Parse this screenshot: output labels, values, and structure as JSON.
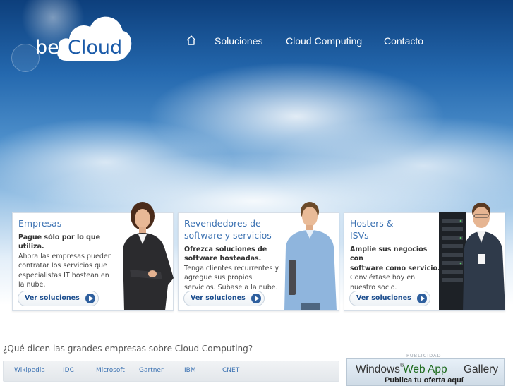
{
  "header": {
    "logo": {
      "part1": "be",
      "part2": "Cloud"
    },
    "nav": [
      {
        "label": "Soluciones"
      },
      {
        "label": "Cloud Computing"
      },
      {
        "label": "Contacto"
      }
    ],
    "home_icon": "home-icon"
  },
  "cards": [
    {
      "title_line1": "Empresas",
      "title_line2": "",
      "bold_lines": [
        "Pague sólo por lo que",
        "utiliza."
      ],
      "lines": [
        "Ahora las empresas pueden",
        "contratar los servicios que",
        "especialistas IT hostean en",
        "la nube."
      ],
      "button": "Ver soluciones"
    },
    {
      "title_line1": "Revendedores de",
      "title_line2": "software y servicios",
      "bold_lines": [
        "Ofrezca soluciones de",
        "software hosteadas."
      ],
      "lines": [
        "Tenga clientes recurrentes y",
        "agregue sus propios",
        "servicios. Súbase a la nube."
      ],
      "button": "Ver soluciones"
    },
    {
      "title_line1": "Hosters &",
      "title_line2": "ISVs",
      "bold_lines": [
        "Amplíe sus negocios con",
        "software como servicio."
      ],
      "lines": [
        "Conviértase hoy en",
        "nuestro socio."
      ],
      "button": "Ver soluciones"
    }
  ],
  "press": {
    "question": "¿Qué dicen las grandes empresas sobre Cloud Computing?",
    "tabs": [
      "Wikipedia",
      "IDC",
      "Microsoft",
      "Gartner",
      "IBM",
      "CNET"
    ]
  },
  "ad": {
    "label": "PUBLICIDAD",
    "windows": "Windows",
    "reg": "®",
    "webapp": "Web App",
    "gallery": "Gallery",
    "cta": "Publica tu oferta aquí"
  },
  "colors": {
    "accent": "#3c72b2",
    "sky_dark": "#0d3f7c",
    "button_arrow": "#2e5f9e"
  }
}
